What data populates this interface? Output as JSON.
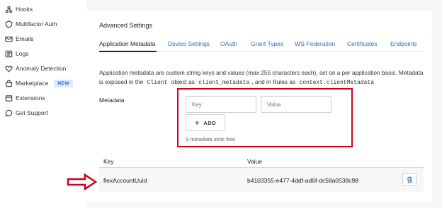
{
  "sidebar": {
    "items": [
      {
        "label": "Hooks",
        "icon": "hooks-icon"
      },
      {
        "label": "Multifactor Auth",
        "icon": "shield-icon"
      },
      {
        "label": "Emails",
        "icon": "envelope-icon"
      },
      {
        "label": "Logs",
        "icon": "logs-icon"
      },
      {
        "label": "Anomaly Detection",
        "icon": "heart-icon"
      },
      {
        "label": "Marketplace",
        "icon": "marketplace-icon",
        "badge": "NEW"
      },
      {
        "label": "Extensions",
        "icon": "extensions-icon"
      },
      {
        "label": "Get Support",
        "icon": "chat-icon"
      }
    ]
  },
  "main": {
    "section_title": "Advanced Settings",
    "tabs": [
      {
        "label": "Application Metadata",
        "active": true
      },
      {
        "label": "Device Settings"
      },
      {
        "label": "OAuth"
      },
      {
        "label": "Grant Types"
      },
      {
        "label": "WS-Federation"
      },
      {
        "label": "Certificates"
      },
      {
        "label": "Endpoints"
      }
    ],
    "description": {
      "part1": "Application metadata are custom string keys and values (max 255 characters each), set on a per application basis. Metadata is exposed in the",
      "code1": "Client",
      "part2": "object as",
      "code2": "client_metadata",
      "part3": ", and in Rules as",
      "code3": "context.clientMetadata"
    },
    "metadata_label": "Metadata",
    "key_placeholder": "Key",
    "value_placeholder": "Value",
    "add_label": "ADD",
    "slots_text": "9 metadata slots free",
    "table": {
      "headers": [
        "Key",
        "Value"
      ],
      "rows": [
        {
          "key": "flexAccountUuid",
          "value": "b4103355-e477-4ddf-ad6f-dc58a0538c98"
        }
      ]
    }
  },
  "colors": {
    "link": "#2c6fbb",
    "annotation_red": "#d0021b",
    "badge_bg": "#dbe9ff",
    "badge_text": "#2a5bd7"
  }
}
